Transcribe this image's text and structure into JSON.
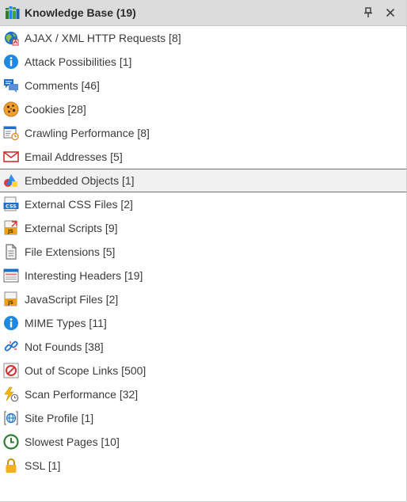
{
  "panel": {
    "title": "Knowledge Base (19)",
    "pin_icon": "pin-icon",
    "close_icon": "close-icon"
  },
  "items": [
    {
      "label": "AJAX / XML HTTP Requests [8]",
      "icon": "ajax-globe-icon"
    },
    {
      "label": "Attack Possibilities [1]",
      "icon": "info-icon"
    },
    {
      "label": "Comments [46]",
      "icon": "comments-icon"
    },
    {
      "label": "Cookies [28]",
      "icon": "cookie-icon"
    },
    {
      "label": "Crawling Performance [8]",
      "icon": "crawling-performance-icon"
    },
    {
      "label": "Email Addresses [5]",
      "icon": "email-icon"
    },
    {
      "label": "Embedded Objects [1]",
      "icon": "embedded-objects-icon"
    },
    {
      "label": "External CSS Files [2]",
      "icon": "css-file-icon"
    },
    {
      "label": "External Scripts [9]",
      "icon": "external-script-icon"
    },
    {
      "label": "File Extensions [5]",
      "icon": "file-icon"
    },
    {
      "label": "Interesting Headers [19]",
      "icon": "headers-icon"
    },
    {
      "label": "JavaScript Files [2]",
      "icon": "js-file-icon"
    },
    {
      "label": "MIME Types [11]",
      "icon": "info-icon"
    },
    {
      "label": "Not Founds [38]",
      "icon": "broken-link-icon"
    },
    {
      "label": "Out of Scope Links [500]",
      "icon": "out-of-scope-icon"
    },
    {
      "label": "Scan Performance [32]",
      "icon": "scan-performance-icon"
    },
    {
      "label": "Site Profile [1]",
      "icon": "site-profile-icon"
    },
    {
      "label": "Slowest Pages [10]",
      "icon": "clock-icon"
    },
    {
      "label": "SSL [1]",
      "icon": "lock-icon"
    }
  ],
  "selected_item": "Embedded Objects [1]",
  "colors": {
    "titlebar_bg": "#dcdcdc",
    "selected_bg": "#f1f1f1",
    "info_blue": "#1e88e5",
    "email_red": "#d32f2f",
    "clock_green": "#2e7d32",
    "lock_yellow": "#f2b01e",
    "js_orange": "#f0a020"
  }
}
